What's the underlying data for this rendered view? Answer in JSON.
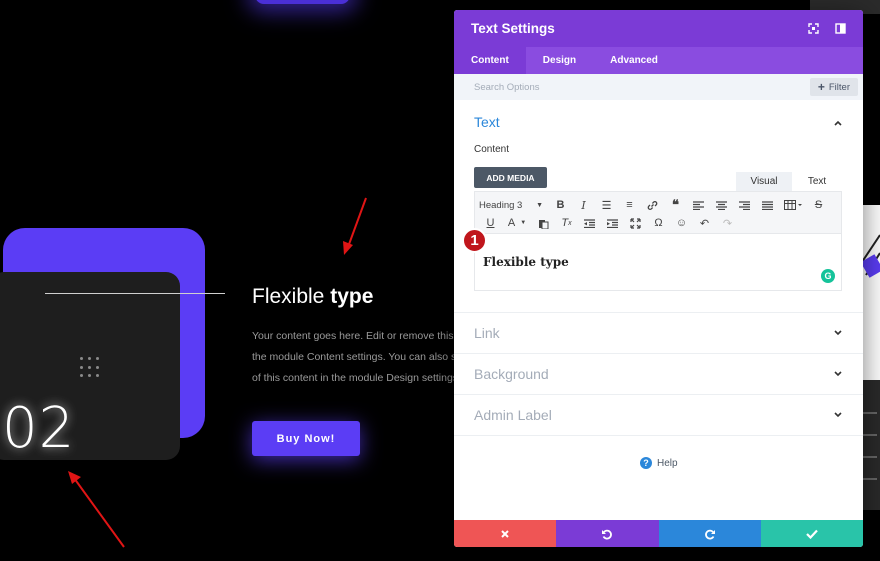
{
  "preview": {
    "number": "02",
    "title_regular": "Flexible ",
    "title_bold": "type",
    "body_lines": [
      "Your content goes here. Edit or remove this te",
      "the module Content settings. You can also styl",
      "of this content in the module Design settings."
    ],
    "button_label": "Buy Now!"
  },
  "panel": {
    "title": "Text Settings",
    "header_icons": [
      "expand-icon",
      "sidebar-toggle-icon"
    ],
    "tabs": [
      {
        "label": "Content",
        "active": true
      },
      {
        "label": "Design",
        "active": false
      },
      {
        "label": "Advanced",
        "active": false
      }
    ],
    "search_placeholder": "Search Options",
    "filter_label": "Filter",
    "text_section": {
      "heading": "Text",
      "content_label": "Content",
      "add_media": "ADD MEDIA",
      "editor_tabs": [
        "Visual",
        "Text"
      ],
      "format_select": "Heading 3",
      "editor_content": "Flexible type",
      "badge": "1"
    },
    "collapsed_sections": [
      "Link",
      "Background",
      "Admin Label"
    ],
    "help_label": "Help"
  },
  "colors": {
    "header": "#7b3bd6",
    "tabs": "#8a4ce0",
    "accent_blue": "#2b87da",
    "cancel": "#ef5555",
    "undo": "#7b3bd6",
    "redo": "#2b87da",
    "save": "#29c4a9",
    "preview_purple": "#5b3df5"
  }
}
